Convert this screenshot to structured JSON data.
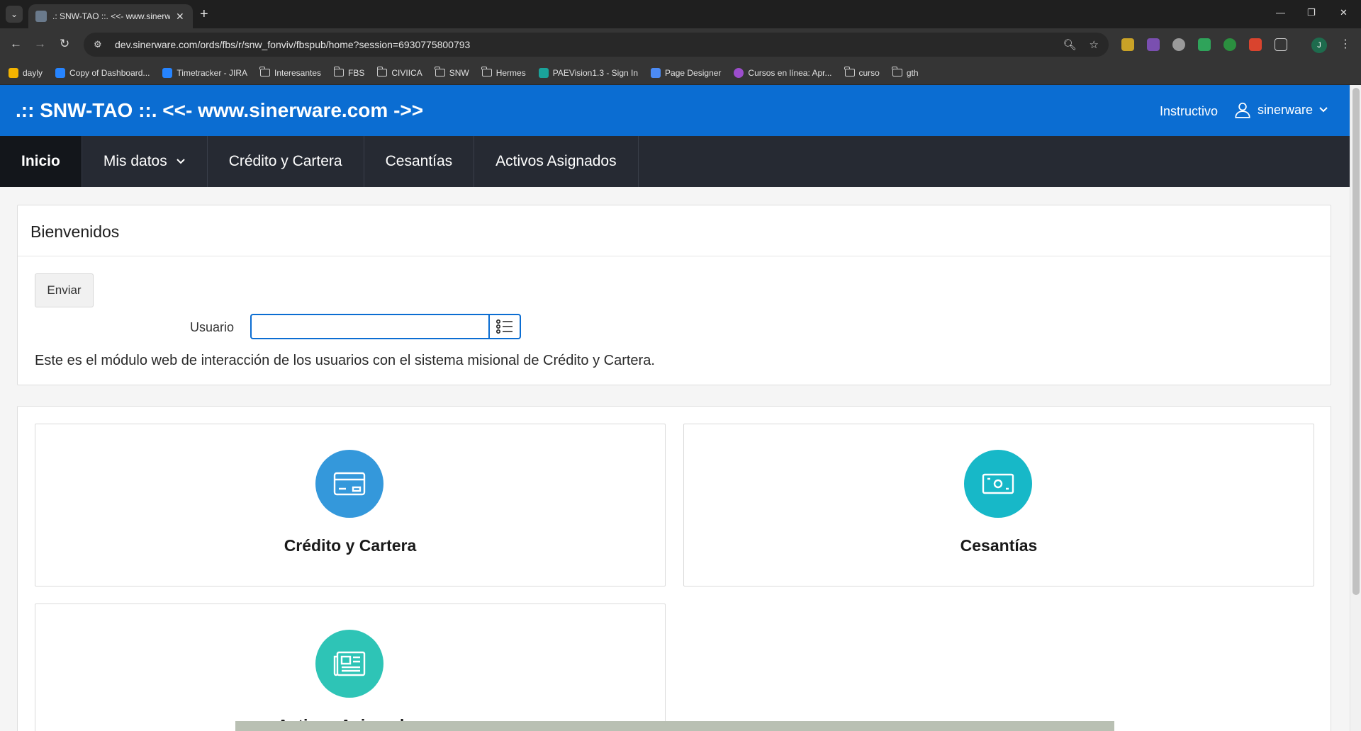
{
  "browser": {
    "tab_title": ".: SNW-TAO ::. <<- www.sinerw",
    "url": "dev.sinerware.com/ords/fbs/r/snw_fonviv/fbspub/home?session=6930775800793",
    "profile_initial": "J",
    "bookmarks": [
      {
        "label": "dayly",
        "icon": "drive-icon"
      },
      {
        "label": "Copy of Dashboard...",
        "icon": "jira-icon"
      },
      {
        "label": "Timetracker - JIRA",
        "icon": "jira-icon"
      },
      {
        "label": "Interesantes",
        "icon": "folder-icon"
      },
      {
        "label": "FBS",
        "icon": "folder-icon"
      },
      {
        "label": "CIVIICA",
        "icon": "folder-icon"
      },
      {
        "label": "SNW",
        "icon": "folder-icon"
      },
      {
        "label": "Hermes",
        "icon": "folder-icon"
      },
      {
        "label": "PAEVision1.3 - Sign In",
        "icon": "page-icon"
      },
      {
        "label": "Page Designer",
        "icon": "apex-icon"
      },
      {
        "label": "Cursos en línea: Apr...",
        "icon": "course-icon"
      },
      {
        "label": "curso",
        "icon": "folder-icon"
      },
      {
        "label": "gth",
        "icon": "folder-icon"
      }
    ]
  },
  "app": {
    "title": ".:: SNW-TAO ::. <<- www.sinerware.com ->>",
    "help_link": "Instructivo",
    "user": "sinerware",
    "brand_color": "#0b6dd2"
  },
  "nav": {
    "items": [
      {
        "label": "Inicio",
        "active": true
      },
      {
        "label": "Mis datos",
        "has_submenu": true
      },
      {
        "label": "Crédito y Cartera"
      },
      {
        "label": "Cesantías"
      },
      {
        "label": "Activos Asignados"
      }
    ]
  },
  "welcome": {
    "heading": "Bienvenidos",
    "submit_label": "Enviar",
    "user_field_label": "Usuario",
    "user_field_value": "",
    "intro": "Este es el módulo web de interacción de los usuarios con el sistema misional de Crédito y Cartera."
  },
  "cards": [
    {
      "title": "Crédito y Cartera",
      "icon": "credit-card-icon",
      "color": "#3498db"
    },
    {
      "title": "Cesantías",
      "icon": "money-icon",
      "color": "#17b8c8"
    },
    {
      "title": "Activos Asignados",
      "icon": "newspaper-icon",
      "color": "#2ec4b6"
    }
  ]
}
